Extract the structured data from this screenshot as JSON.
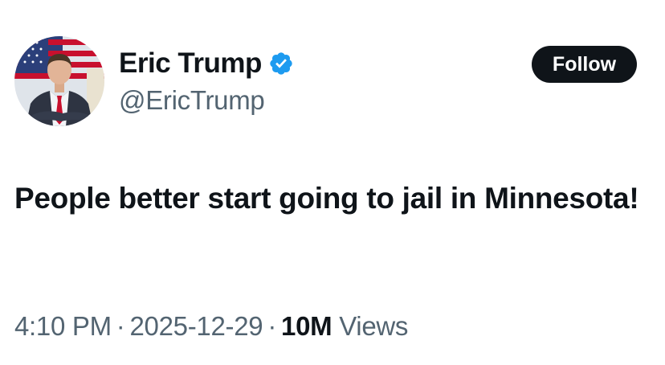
{
  "author": {
    "display_name": "Eric Trump",
    "handle": "@EricTrump",
    "verified": true,
    "verified_icon": "verified-badge-icon",
    "verified_color": "#1d9bf0"
  },
  "follow_button": {
    "label": "Follow"
  },
  "tweet": {
    "text": "People better start going to jail in Minnesota!"
  },
  "meta": {
    "time": "4:10 PM",
    "separator": "·",
    "date": "2025-12-29",
    "views_count": "10M",
    "views_label": "Views"
  },
  "colors": {
    "text_primary": "#0f1419",
    "text_secondary": "#536471",
    "button_bg": "#0f1419",
    "button_text": "#ffffff"
  }
}
